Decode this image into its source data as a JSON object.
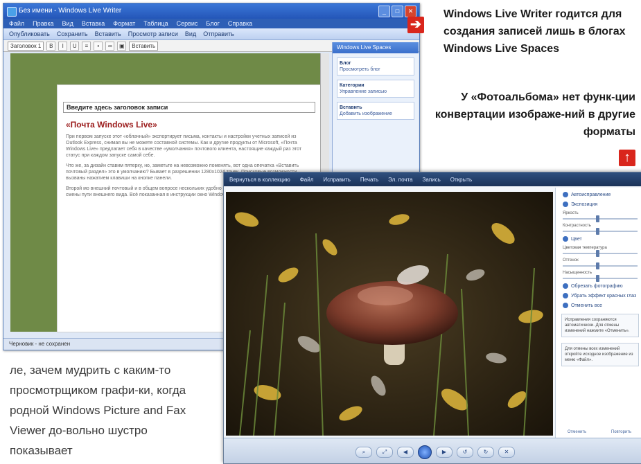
{
  "wlw": {
    "title": "Без имени - Windows Live Writer",
    "menu": [
      "Файл",
      "Правка",
      "Вид",
      "Вставка",
      "Формат",
      "Таблица",
      "Сервис",
      "Блог",
      "Справка"
    ],
    "commands": [
      "Опубликовать",
      "Сохранить",
      "Вставить",
      "Просмотр записи",
      "Вид",
      "Отправить"
    ],
    "format": {
      "style": "Заголовок 1",
      "insert": "Вставить"
    },
    "title_placeholder": "Введите здесь заголовок записи",
    "post_heading": "«Почта Windows Live»",
    "paragraphs": [
      "При первом запуске этот «облачный» экспортирует письма, контакты и настройки учетных записей из Outlook Express, снимая вы не можете составной системы. Как и другие продукты от Microsoft, «Почта Windows Live» предлагает себя в качестве «умолчания» почтового клиента, настоящие каждый раз этот статус при каждом запуске самой себе.",
      "Что же, за дизайн ставим пятерку, но, заметьте на невозможно поменять, вот одна опечатка «Вставить почтовый раздел» это в умолчанию? Бывает в разрешении 1280x1024 точек. Поисковые возможности вызваны нажатием клавиши на кнопке панели.",
      "Второй мо внешний почтовый и в общем вопросе нескольких удобно в контакте прочего вида, обработаны смены пути внешнего вида. Всё показанная в инструкции окно Windows Vista не старается."
    ],
    "sidebar": {
      "header": "Windows Live Spaces",
      "blog_panel_title": "Блог",
      "blog_panel_text": "Просмотреть блог",
      "section1_title": "Категории",
      "section1_text": "Управление записью",
      "section2_title": "Вставить",
      "section2_text": "Добавить изображение"
    },
    "status": "Черновик - не сохранен"
  },
  "gallery": {
    "toolbar": [
      "Вернуться в коллекцию",
      "Файл",
      "Исправить",
      "Печать",
      "Эл. почта",
      "Запись",
      "Открыть"
    ],
    "sidebar": {
      "auto_adjust": "Автоисправление",
      "exposure": "Экспозиция",
      "brightness_label": "Яркость",
      "contrast_label": "Контрастность",
      "color_label": "Цвет",
      "temperature_label": "Цветовая температура",
      "tint_label": "Оттенок",
      "saturation_label": "Насыщенность",
      "crop": "Обрезать фотографию",
      "redeye": "Убрать эффект красных глаз",
      "undo": "Отменить все",
      "note1": "Исправления сохраняются автоматически. Для отмены изменений нажмите «Отменить».",
      "note2": "Для отмены всех изменений откройте исходное изображение из меню «Файл».",
      "foot_left": "Отменить",
      "foot_right": "Повторить"
    },
    "nav": {
      "zoom": "⌕",
      "fit": "⤢",
      "prev": "◀",
      "next": "▶",
      "rotate_left": "↺",
      "rotate_right": "↻",
      "delete": "✕"
    }
  },
  "captions": {
    "wlw": "Windows Live Writer годится для создания записей лишь в блогах Windows Live Spaces",
    "gallery": "У «Фотоальбома» нет функ-ции конвертации изображе-ний в другие форматы"
  },
  "body_text": "ле, зачем мудрить с каким-то просмотрщиком графи-ки, когда родной Windows Picture and Fax Viewer до-вольно шустро показывает",
  "arrows": {
    "right": "➔",
    "up": "↑"
  },
  "colors": {
    "arrow_red": "#d9261c",
    "wlw_blue": "#2e5fb6",
    "canvas_green": "#6f8a47",
    "heading_red": "#9b1c1c"
  }
}
